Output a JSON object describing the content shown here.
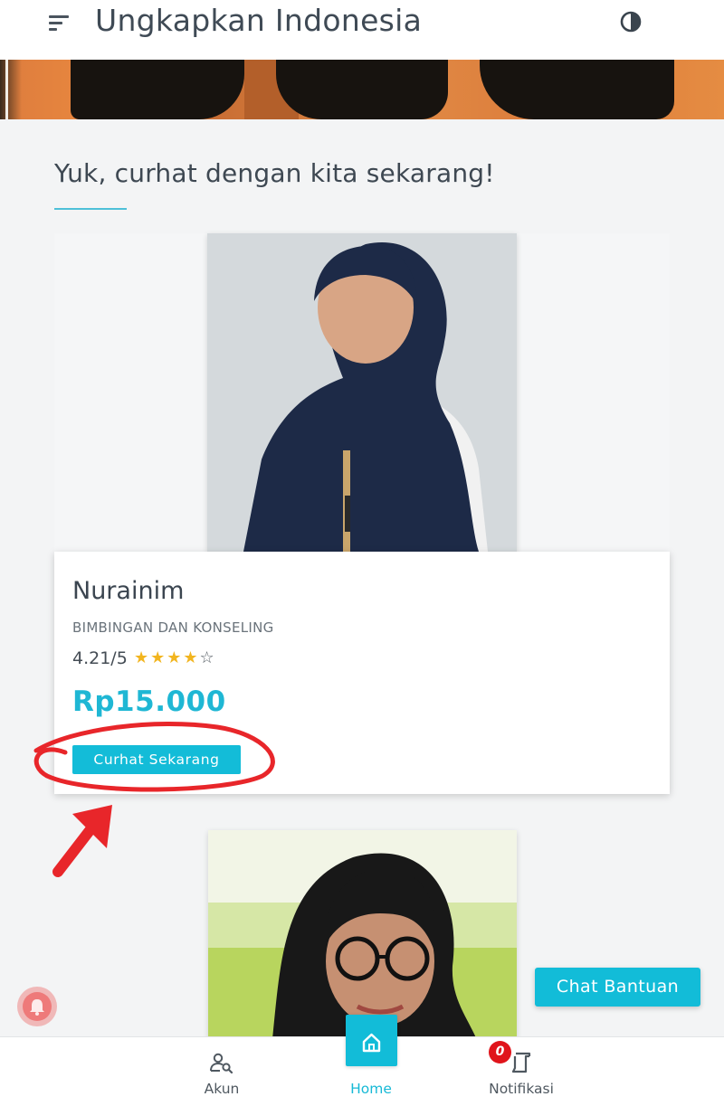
{
  "app": {
    "title": "Ungkapkan Indonesia",
    "accent_color": "#12bcd8"
  },
  "section": {
    "title": "Yuk, curhat dengan kita sekarang!"
  },
  "counselors": [
    {
      "name": "Nurainim",
      "department": "BIMBINGAN DAN KONSELING",
      "rating_text": "4.21/5",
      "rating_value": 4.21,
      "stars_filled": "★★★★",
      "stars_empty": "☆",
      "price": "Rp15.000",
      "cta_label": "Curhat Sekarang"
    }
  ],
  "chat_help": {
    "label": "Chat Bantuan"
  },
  "bottom_nav": {
    "akun_label": "Akun",
    "home_label": "Home",
    "notif_label": "Notifikasi",
    "notif_count": "0"
  },
  "icons": {
    "menu": "menu-icon",
    "theme": "contrast-icon",
    "akun": "user-search-icon",
    "home": "home-icon",
    "notif": "notification-icon",
    "bell": "bell-icon"
  },
  "annotation_color": "#e8262a"
}
